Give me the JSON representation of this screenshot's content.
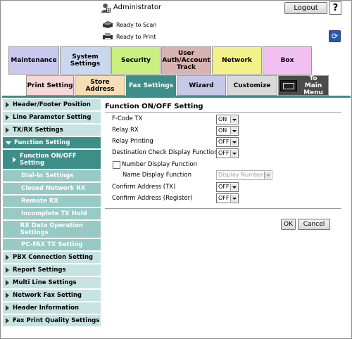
{
  "header": {
    "user_label": "Administrator",
    "logout_label": "Logout",
    "help_label": "?",
    "status_scan": "Ready to Scan",
    "status_print": "Ready to Print"
  },
  "category_tabs": [
    {
      "label": "Maintenance",
      "color": "#c9c9ef"
    },
    {
      "label": "System Settings",
      "color": "#c9d7ef"
    },
    {
      "label": "Security",
      "color": "#c9ef7f"
    },
    {
      "label": "User Auth/Account Track",
      "color": "#d9b2b2"
    },
    {
      "label": "Network",
      "color": "#f2f28a"
    },
    {
      "label": "Box",
      "color": "#f2bff2"
    }
  ],
  "sub_tabs": [
    {
      "label": "Print Setting",
      "color": "#f7d7d7"
    },
    {
      "label": "Store Address",
      "color": "#f7ddb5"
    },
    {
      "label": "Fax Settings",
      "color": "#3d8e88"
    },
    {
      "label": "Wizard",
      "color": "#c7c7e8"
    },
    {
      "label": "Customize",
      "color": "#d9d9d9"
    },
    {
      "label": "To Main Menu",
      "color": "#4b4b4b"
    }
  ],
  "sidebar": {
    "items": [
      {
        "label": "Header/Footer Position"
      },
      {
        "label": "Line Parameter Setting"
      },
      {
        "label": "TX/RX Settings"
      },
      {
        "label": "Function Setting"
      },
      {
        "label": "Function ON/OFF Setting"
      },
      {
        "label": "Dial-In Settings"
      },
      {
        "label": "Closed Network RX"
      },
      {
        "label": "Remote RX"
      },
      {
        "label": "Incomplete TX Hold"
      },
      {
        "label": "RX Data Operation Settings"
      },
      {
        "label": "PC-FAX TX Setting"
      },
      {
        "label": "PBX Connection Setting"
      },
      {
        "label": "Report Settings"
      },
      {
        "label": "Multi Line Settings"
      },
      {
        "label": "Network Fax Setting"
      },
      {
        "label": "Header Information"
      },
      {
        "label": "Fax Print Quality Settings"
      }
    ]
  },
  "main": {
    "title": "Function ON/OFF Setting",
    "rows": [
      {
        "label": "F-Code TX",
        "value": "ON"
      },
      {
        "label": "Relay RX",
        "value": "ON"
      },
      {
        "label": "Relay Printing",
        "value": "OFF"
      },
      {
        "label": "Destination Check Display Function",
        "value": "OFF"
      },
      {
        "label": "Number Display Function"
      },
      {
        "label": "Name Display Function",
        "value": "Display Number"
      },
      {
        "label": "Confirm Address (TX)",
        "value": "OFF"
      },
      {
        "label": "Confirm Address (Register)",
        "value": "OFF"
      }
    ],
    "ok_label": "OK",
    "cancel_label": "Cancel"
  }
}
